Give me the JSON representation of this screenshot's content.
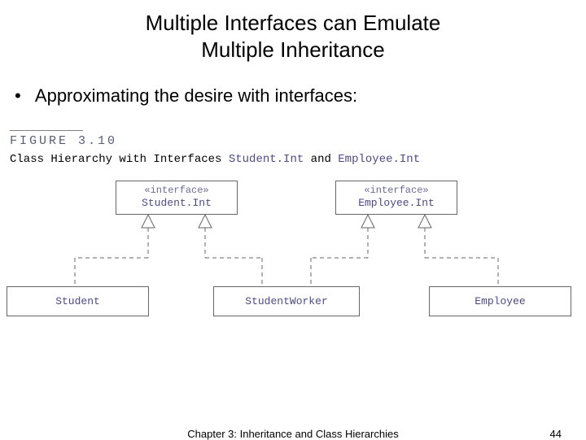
{
  "title_line1": "Multiple Interfaces can Emulate",
  "title_line2": "Multiple Inheritance",
  "bullet": "Approximating the desire with interfaces:",
  "figure": {
    "label": "FIGURE 3.10",
    "caption_prefix": "Class Hierarchy with Interfaces ",
    "iface1": "Student.Int",
    "caption_mid": " and ",
    "iface2": "Employee.Int"
  },
  "diagram": {
    "stereotype": "«interface»",
    "interface_student": "Student.Int",
    "interface_employee": "Employee.Int",
    "class_student": "Student",
    "class_studentworker": "StudentWorker",
    "class_employee": "Employee"
  },
  "footer": {
    "chapter": "Chapter 3: Inheritance and Class Hierarchies",
    "page": "44"
  }
}
